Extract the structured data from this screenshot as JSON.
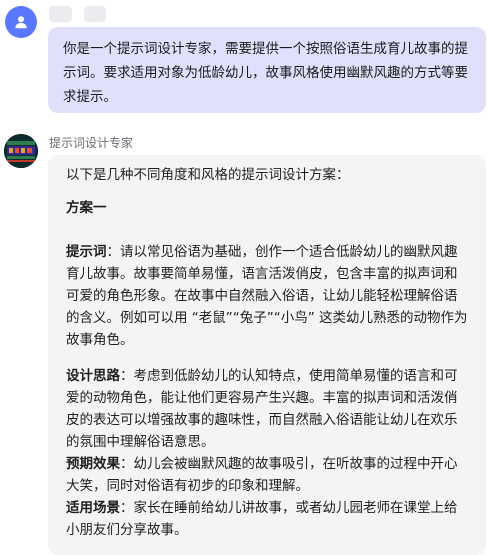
{
  "user": {
    "avatar_icon": "user-avatar-icon",
    "message": "你是一个提示词设计专家，需要提供一个按照俗语生成育儿故事的提示词。要求适用对象为低龄幼儿，故事风格使用幽默风趣的方式等要求提示。"
  },
  "assistant": {
    "name": "提示词设计专家",
    "avatar_icon": "assistant-avatar-image",
    "intro": "以下是几种不同角度和风格的提示词设计方案：",
    "plan_title": "方案一",
    "prompt_label": "提示词",
    "prompt_text": "：请以常见俗语为基础，创作一个适合低龄幼儿的幽默风趣育儿故事。故事要简单易懂，语言活泼俏皮，包含丰富的拟声词和可爱的角色形象。在故事中自然融入俗语，让幼儿能轻松理解俗语的含义。例如可以用 “老鼠”“兔子”“小鸟” 这类幼儿熟悉的动物作为故事角色。",
    "design_label": "设计思路",
    "design_text": "：考虑到低龄幼儿的认知特点，使用简单易懂的语言和可爱的动物角色，能让他们更容易产生兴趣。丰富的拟声词和活泼俏皮的表达可以增强故事的趣味性，而自然融入俗语能让幼儿在欢乐的氛围中理解俗语意思。",
    "effect_label": "预期效果",
    "effect_text": "：幼儿会被幽默风趣的故事吸引，在听故事的过程中开心大笑，同时对俗语有初步的印象和理解。",
    "scene_label": "适用场景",
    "scene_text": "：家长在睡前给幼儿讲故事，或者幼儿园老师在课堂上给小朋友们分享故事。"
  }
}
